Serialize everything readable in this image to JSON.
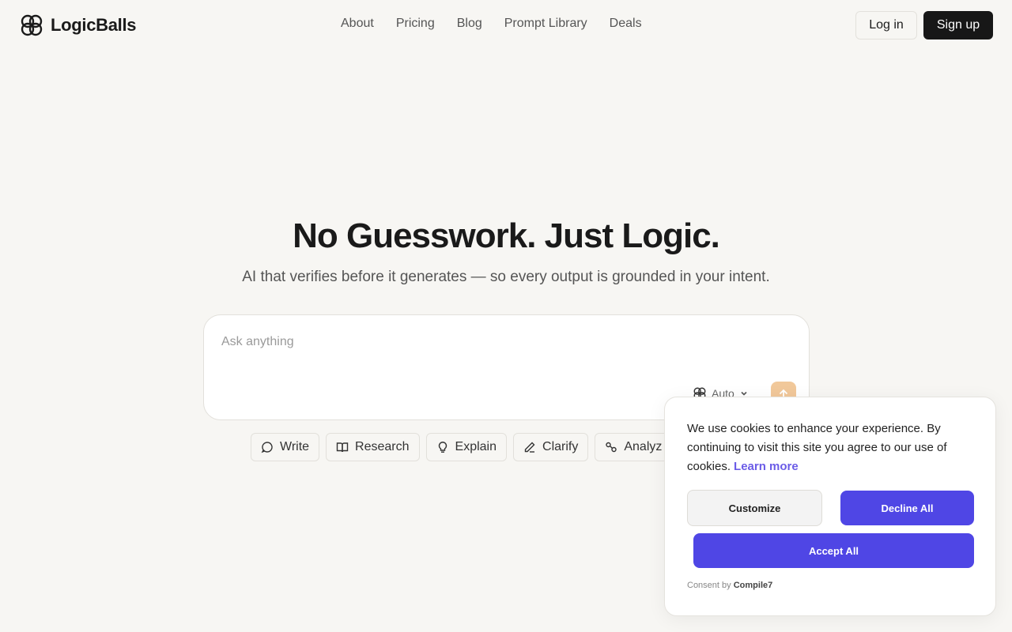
{
  "header": {
    "brand": "LogicBalls",
    "nav": [
      "About",
      "Pricing",
      "Blog",
      "Prompt Library",
      "Deals"
    ],
    "login_label": "Log in",
    "signup_label": "Sign up"
  },
  "hero": {
    "title": "No Guesswork. Just Logic.",
    "subtitle": "AI that verifies before it generates — so every output is grounded in your intent."
  },
  "prompt": {
    "placeholder": "Ask anything",
    "model_label": "Auto"
  },
  "chips": [
    {
      "label": "Write",
      "icon": "chat-bubble-icon"
    },
    {
      "label": "Research",
      "icon": "book-icon"
    },
    {
      "label": "Explain",
      "icon": "lightbulb-icon"
    },
    {
      "label": "Clarify",
      "icon": "pencil-icon"
    },
    {
      "label": "Analyz",
      "icon": "analyze-icon"
    }
  ],
  "cookie": {
    "text": "We use cookies to enhance your experience. By continuing to visit this site you agree to our use of cookies.",
    "learn_more": "Learn more",
    "customize_label": "Customize",
    "decline_label": "Decline All",
    "accept_label": "Accept All",
    "consent_prefix": "Consent by",
    "consent_brand": "Compile7"
  },
  "colors": {
    "background": "#f7f6f3",
    "accent": "#4f46e5",
    "send_button": "#f1c89a",
    "link": "#6b5ce7"
  }
}
